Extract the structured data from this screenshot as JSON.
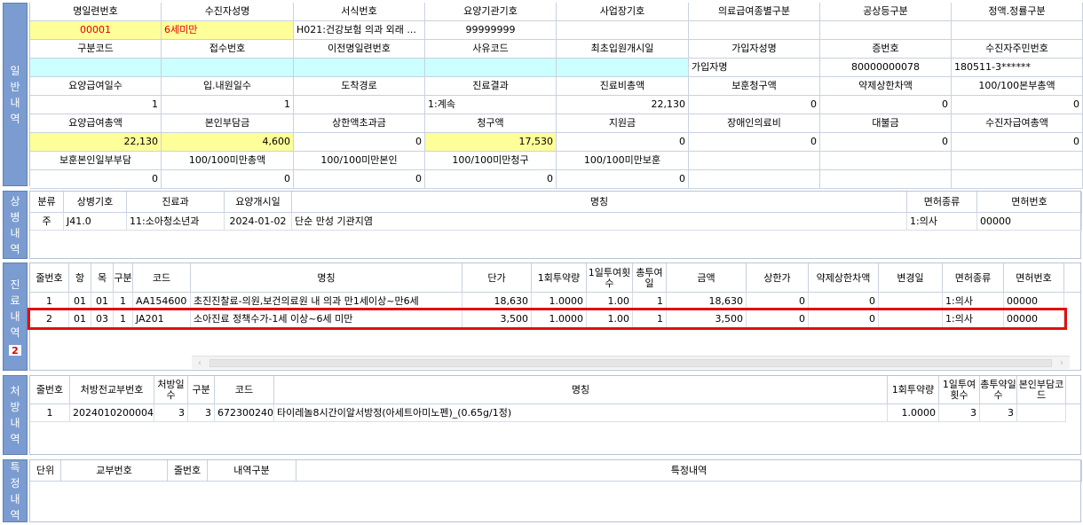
{
  "general": {
    "side_title": [
      "일",
      "반",
      "내",
      "역"
    ],
    "rows": [
      {
        "labels": [
          "명일련번호",
          "수진자성명",
          "서식번호",
          "요양기관기호",
          "사업장기호",
          "의료급여종별구분",
          "공상등구분",
          "정액.정률구분"
        ],
        "values": [
          "00001",
          "6세미만",
          "H021:건강보험 의과 외래 ...",
          "99999999",
          "",
          "",
          "",
          ""
        ]
      },
      {
        "labels": [
          "구분코드",
          "접수번호",
          "이전명일련번호",
          "사유코드",
          "최초입원개시일",
          "가입자성명",
          "증번호",
          "수진자주민번호"
        ],
        "values": [
          "",
          "",
          "",
          "",
          "",
          "가입자명",
          "80000000078",
          "180511-3******"
        ]
      },
      {
        "labels": [
          "요양급여일수",
          "입.내원일수",
          "도착경로",
          "진료결과",
          "진료비총액",
          "보훈청구액",
          "약제상한차액",
          "100/100본부총액"
        ],
        "values": [
          "1",
          "1",
          "",
          "1:계속",
          "22,130",
          "0",
          "0",
          "0"
        ]
      },
      {
        "labels": [
          "요양급여총액",
          "본인부담금",
          "상한액초과금",
          "청구액",
          "지원금",
          "장애인의료비",
          "대불금",
          "수진자급여총액"
        ],
        "values": [
          "22,130",
          "4,600",
          "0",
          "17,530",
          "0",
          "0",
          "0",
          "0"
        ]
      },
      {
        "labels": [
          "보훈본인일부부담",
          "100/100미만총액",
          "100/100미만본인",
          "100/100미만청구",
          "100/100미만보훈",
          "",
          "",
          ""
        ],
        "values": [
          "0",
          "0",
          "0",
          "0",
          "0",
          "",
          "",
          ""
        ]
      }
    ]
  },
  "disease": {
    "side_title": [
      "상",
      "병",
      "내",
      "역"
    ],
    "headers": [
      "분류",
      "상병기호",
      "진료과",
      "요양개시일",
      "명칭",
      "면허종류",
      "면허번호"
    ],
    "rows": [
      [
        "주",
        "J41.0",
        "11:소아청소년과",
        "2024-01-02",
        "단순 만성 기관지염",
        "1:의사",
        "00000"
      ]
    ]
  },
  "treatment": {
    "side_title": [
      "진",
      "료",
      "내",
      "역"
    ],
    "badge": "2",
    "headers": [
      "줄번호",
      "항",
      "목",
      "구분",
      "코드",
      "명칭",
      "단가",
      "1회투약량",
      "1일투여횟수",
      "총투여일",
      "금액",
      "상한가",
      "약제상한차액",
      "변경일",
      "면허종류",
      "면허번호"
    ],
    "rows": [
      [
        "1",
        "01",
        "01",
        "1",
        "AA154600",
        "초진진찰료-의원,보건의료원 내 의과 만1세이상~만6세",
        "18,630",
        "1.0000",
        "1.00",
        "1",
        "18,630",
        "0",
        "0",
        "",
        "1:의사",
        "00000"
      ],
      [
        "2",
        "01",
        "03",
        "1",
        "JA201",
        "소아진료 정책수가-1세 이상~6세 미만",
        "3,500",
        "1.0000",
        "1.00",
        "1",
        "3,500",
        "0",
        "0",
        "",
        "1:의사",
        "00000"
      ]
    ],
    "scroll_left": "‹",
    "scroll_right": "›"
  },
  "prescription": {
    "side_title": [
      "처",
      "방",
      "내",
      "역"
    ],
    "headers": [
      "줄번호",
      "처방전교부번호",
      "처방일수",
      "구분",
      "코드",
      "명칭",
      "1회투약량",
      "1일투여횟수",
      "총투약일수",
      "본인부담코드"
    ],
    "rows": [
      [
        "1",
        "2024010200004",
        "3",
        "3",
        "672300240",
        "타이레놀8시간이알서방정(아세트아미노펜)_(0.65g/1정)",
        "1.0000",
        "3",
        "3",
        ""
      ]
    ]
  },
  "special": {
    "side_title": [
      "특",
      "정",
      "내",
      "역"
    ],
    "headers": [
      "단위",
      "교부번호",
      "줄번호",
      "내역구분",
      "특정내역"
    ]
  }
}
